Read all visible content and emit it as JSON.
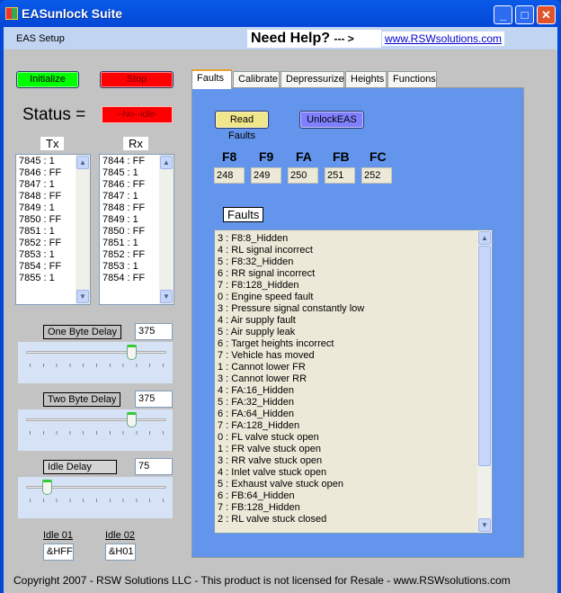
{
  "window": {
    "title": "EASunlock Suite",
    "controls": [
      "minimize",
      "maximize",
      "close"
    ]
  },
  "menu": {
    "eas_setup": "EAS Setup",
    "need_help": "Need Help?",
    "arrow": "--- >",
    "link": "www.RSWsolutions.com"
  },
  "left": {
    "initialize": "Initialize",
    "stop": "Stop",
    "status_label": "Status =",
    "status_value": "--No--Idle-",
    "tx_label": "Tx",
    "rx_label": "Rx",
    "tx": [
      "7845 : 1",
      "7846 : FF",
      "7847 : 1",
      "7848 : FF",
      "7849 : 1",
      "7850 : FF",
      "7851 : 1",
      "7852 : FF",
      "7853 : 1",
      "7854 : FF",
      "7855 : 1"
    ],
    "rx": [
      "7844 : FF",
      "7845 : 1",
      "7846 : FF",
      "7847 : 1",
      "7848 : FF",
      "7849 : 1",
      "7850 : FF",
      "7851 : 1",
      "7852 : FF",
      "7853 : 1",
      "7854 : FF"
    ],
    "sliders": [
      {
        "label": "One Byte Delay",
        "value": "375",
        "level": 0.75
      },
      {
        "label": "Two Byte Delay",
        "value": "375",
        "level": 0.75
      },
      {
        "label": "Idle Delay",
        "value": "75",
        "level": 0.15
      }
    ],
    "idle01_label": "Idle 01",
    "idle01": "&HFF",
    "idle02_label": "Idle 02",
    "idle02": "&H01"
  },
  "tabs": [
    "Faults",
    "Calibrate",
    "Depressurize",
    "Heights",
    "Functions"
  ],
  "active_tab": "Faults",
  "faults": {
    "read_faults": "Read Faults",
    "unlock": "UnlockEAS",
    "headers": [
      "F8",
      "F9",
      "FA",
      "FB",
      "FC"
    ],
    "values": [
      "248",
      "249",
      "250",
      "251",
      "252"
    ],
    "list_label": "Faults",
    "items": [
      "3 : F8:8_Hidden",
      "4 : RL signal incorrect",
      "5 : F8:32_Hidden",
      "6 : RR signal incorrect",
      "7 : F8:128_Hidden",
      "0 : Engine speed fault",
      "3 : Pressure signal constantly low",
      "4 : Air supply fault",
      "5 : Air supply leak",
      "6 : Target heights incorrect",
      "7 : Vehicle has moved",
      "1 : Cannot lower FR",
      "3 : Cannot lower RR",
      "4 : FA:16_Hidden",
      "5 : FA:32_Hidden",
      "6 : FA:64_Hidden",
      "7 : FA:128_Hidden",
      "0 : FL valve stuck open",
      "1 : FR valve stuck open",
      "3 : RR valve stuck open",
      "4 : Inlet valve stuck open",
      "5 : Exhaust valve stuck open",
      "6 : FB:64_Hidden",
      "7 : FB:128_Hidden",
      "2 : RL valve stuck closed"
    ]
  },
  "footer": "Copyright 2007 - RSW Solutions LLC - This product is not licensed for Resale - www.RSWsolutions.com",
  "colors": {
    "initialize": "#00ff00",
    "stop": "#ff0000",
    "read_faults": "#f0e68c",
    "unlock": "#8080ff",
    "panel": "#6495ed"
  }
}
